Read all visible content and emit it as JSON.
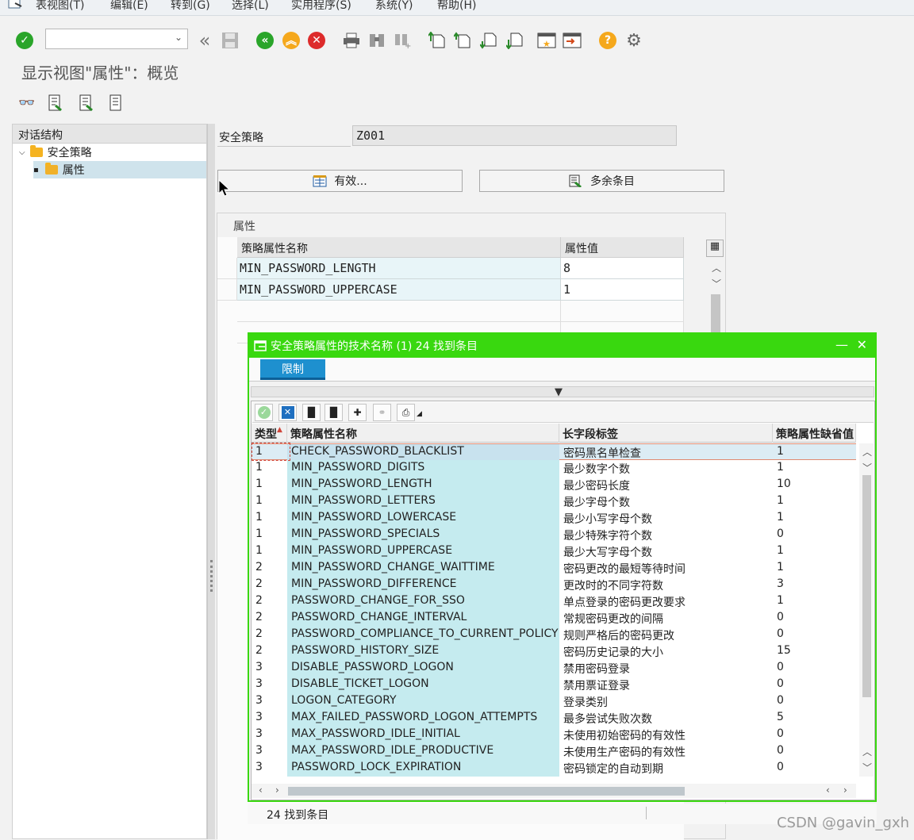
{
  "menubar": {
    "items": [
      "表视图(T)",
      "编辑(E)",
      "转到(G)",
      "选择(L)",
      "实用程序(S)",
      "系统(Y)",
      "帮助(H)"
    ]
  },
  "toolbar": {
    "icons": [
      "enter-check",
      "command-dropdown",
      "back-double-arrow",
      "save-disk",
      "back-green",
      "exit-orange",
      "cancel-red",
      "print",
      "find",
      "find-next",
      "first-page",
      "previous-page",
      "next-page",
      "last-page",
      "new-session",
      "shortcut",
      "help",
      "customize-layout"
    ]
  },
  "page_title": "显示视图\"属性\"：概览",
  "tree": {
    "header": "对话结构",
    "items": [
      {
        "label": "安全策略",
        "level": 0
      },
      {
        "label": "属性",
        "level": 1,
        "selected": true
      }
    ]
  },
  "form": {
    "policy_label": "安全策略",
    "policy_value": "Z001",
    "btn_effective": "有效...",
    "btn_extra": "多余条目"
  },
  "attr_table": {
    "title": "属性",
    "col_name": "策略属性名称",
    "col_value": "属性值",
    "rows": [
      {
        "name": "MIN_PASSWORD_LENGTH",
        "value": "8"
      },
      {
        "name": "MIN_PASSWORD_UPPERCASE",
        "value": "1"
      }
    ]
  },
  "popup": {
    "title": "安全策略属性的技术名称 (1)   24 找到条目",
    "tab_restrict": "限制",
    "columns": [
      "类型",
      "策略属性名称",
      "长字段标签",
      "策略属性缺省值"
    ],
    "rows": [
      [
        "1",
        "CHECK_PASSWORD_BLACKLIST",
        "密码黑名单检查",
        "1"
      ],
      [
        "1",
        "MIN_PASSWORD_DIGITS",
        "最少数字个数",
        "1"
      ],
      [
        "1",
        "MIN_PASSWORD_LENGTH",
        "最少密码长度",
        "10"
      ],
      [
        "1",
        "MIN_PASSWORD_LETTERS",
        "最少字母个数",
        "1"
      ],
      [
        "1",
        "MIN_PASSWORD_LOWERCASE",
        "最少小写字母个数",
        "1"
      ],
      [
        "1",
        "MIN_PASSWORD_SPECIALS",
        "最少特殊字符个数",
        "0"
      ],
      [
        "1",
        "MIN_PASSWORD_UPPERCASE",
        "最少大写字母个数",
        "1"
      ],
      [
        "2",
        "MIN_PASSWORD_CHANGE_WAITTIME",
        "密码更改的最短等待时间",
        "1"
      ],
      [
        "2",
        "MIN_PASSWORD_DIFFERENCE",
        "更改时的不同字符数",
        "3"
      ],
      [
        "2",
        "PASSWORD_CHANGE_FOR_SSO",
        "单点登录的密码更改要求",
        "1"
      ],
      [
        "2",
        "PASSWORD_CHANGE_INTERVAL",
        "常规密码更改的间隔",
        "0"
      ],
      [
        "2",
        "PASSWORD_COMPLIANCE_TO_CURRENT_POLICY",
        "规则严格后的密码更改",
        "0"
      ],
      [
        "2",
        "PASSWORD_HISTORY_SIZE",
        "密码历史记录的大小",
        "15"
      ],
      [
        "3",
        "DISABLE_PASSWORD_LOGON",
        "禁用密码登录",
        "0"
      ],
      [
        "3",
        "DISABLE_TICKET_LOGON",
        "禁用票证登录",
        "0"
      ],
      [
        "3",
        "LOGON_CATEGORY",
        "登录类别",
        "0"
      ],
      [
        "3",
        "MAX_FAILED_PASSWORD_LOGON_ATTEMPTS",
        "最多尝试失败次数",
        "5"
      ],
      [
        "3",
        "MAX_PASSWORD_IDLE_INITIAL",
        "未使用初始密码的有效性",
        "0"
      ],
      [
        "3",
        "MAX_PASSWORD_IDLE_PRODUCTIVE",
        "未使用生产密码的有效性",
        "0"
      ],
      [
        "3",
        "PASSWORD_LOCK_EXPIRATION",
        "密码锁定的自动到期",
        "0"
      ]
    ],
    "status": "24 找到条目"
  },
  "watermark": "CSDN @gavin_gxh",
  "colors": {
    "popup_accent": "#39d80f",
    "tab_active": "#1e90cf",
    "highlight_column": "#c5ebef"
  }
}
